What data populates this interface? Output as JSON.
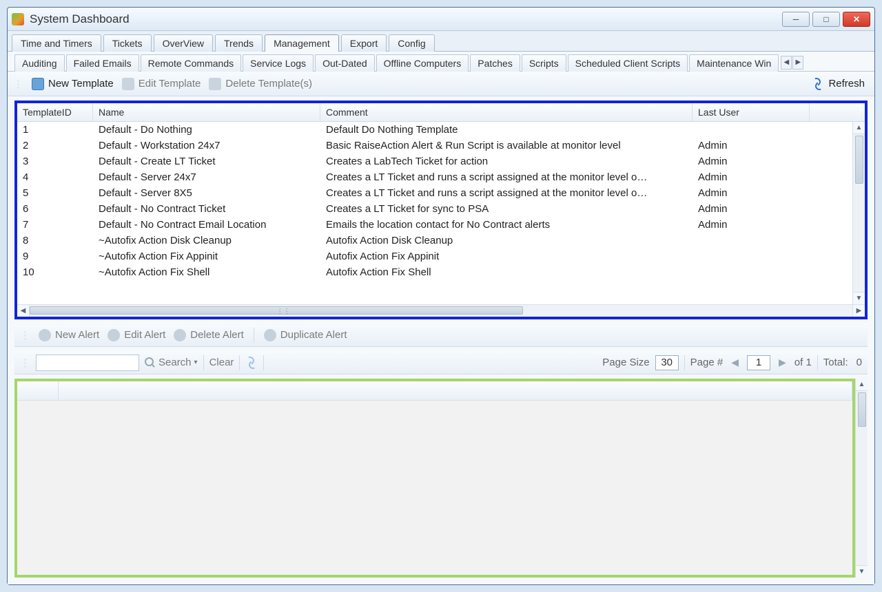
{
  "window": {
    "title": "System Dashboard"
  },
  "primary_tabs": [
    "Time and Timers",
    "Tickets",
    "OverView",
    "Trends",
    "Management",
    "Export",
    "Config"
  ],
  "primary_active": "Management",
  "secondary_tabs": [
    "Auditing",
    "Failed Emails",
    "Remote Commands",
    "Service Logs",
    "Out-Dated",
    "Offline Computers",
    "Patches",
    "Scripts",
    "Scheduled Client Scripts",
    "Maintenance Win"
  ],
  "template_toolbar": {
    "new": "New Template",
    "edit": "Edit Template",
    "delete": "Delete Template(s)",
    "refresh": "Refresh"
  },
  "table": {
    "headers": {
      "id": "TemplateID",
      "name": "Name",
      "comment": "Comment",
      "user": "Last User"
    },
    "rows": [
      {
        "id": "1",
        "name": "Default - Do Nothing",
        "comment": "Default Do Nothing Template",
        "user": ""
      },
      {
        "id": "2",
        "name": "Default - Workstation 24x7",
        "comment": "Basic RaiseAction Alert & Run Script is available at monitor level",
        "user": "Admin"
      },
      {
        "id": "3",
        "name": "Default - Create LT Ticket",
        "comment": "Creates a LabTech Ticket for action",
        "user": "Admin"
      },
      {
        "id": "4",
        "name": "Default - Server 24x7",
        "comment": "Creates a LT Ticket and runs a script assigned at the monitor level o…",
        "user": "Admin"
      },
      {
        "id": "5",
        "name": "Default - Server 8X5",
        "comment": "Creates a LT Ticket and runs a script assigned at the monitor level o…",
        "user": "Admin"
      },
      {
        "id": "6",
        "name": "Default - No Contract Ticket",
        "comment": "Creates a LT Ticket for sync to PSA",
        "user": "Admin"
      },
      {
        "id": "7",
        "name": "Default - No Contract Email Location",
        "comment": "Emails the location contact for No Contract alerts",
        "user": "Admin"
      },
      {
        "id": "8",
        "name": "~Autofix Action Disk Cleanup",
        "comment": "Autofix Action Disk Cleanup",
        "user": ""
      },
      {
        "id": "9",
        "name": "~Autofix Action Fix Appinit",
        "comment": "Autofix Action Fix Appinit",
        "user": ""
      },
      {
        "id": "10",
        "name": "~Autofix Action Fix Shell",
        "comment": "Autofix Action Fix Shell",
        "user": ""
      }
    ]
  },
  "alert_toolbar": {
    "new": "New Alert",
    "edit": "Edit Alert",
    "delete": "Delete Alert",
    "duplicate": "Duplicate Alert"
  },
  "pager": {
    "search": "Search",
    "clear": "Clear",
    "page_size_label": "Page Size",
    "page_size": "30",
    "page_label": "Page #",
    "page": "1",
    "of": "of 1",
    "total_label": "Total:",
    "total": "0"
  }
}
